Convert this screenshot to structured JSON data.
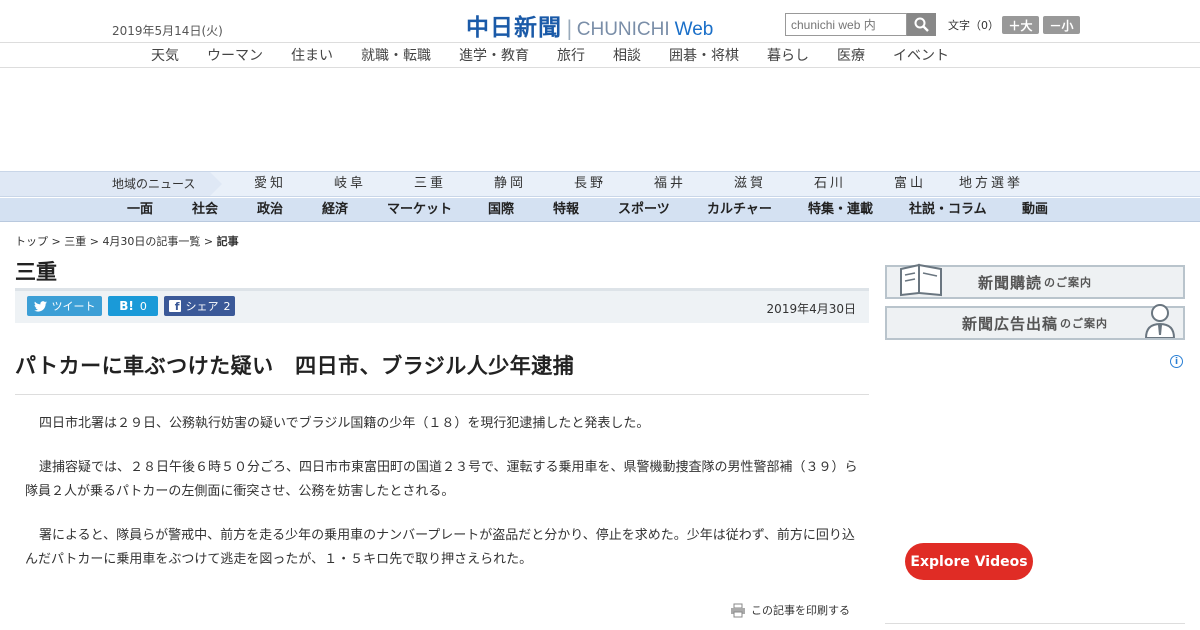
{
  "header": {
    "date": "2019年5月14日(火)",
    "logo_jp": "中日新聞",
    "logo_en": "CHUNICHI",
    "logo_web": "Web",
    "search_placeholder": "chunichi web 内",
    "text_size_label": "文字（0）",
    "enlarge_label": "＋大",
    "shrink_label": "－小"
  },
  "subnav": [
    "天気",
    "ウーマン",
    "住まい",
    "就職・転職",
    "進学・教育",
    "旅行",
    "相談",
    "囲碁・将棋",
    "暮らし",
    "医療",
    "イベント"
  ],
  "regional": {
    "label": "地域のニュース",
    "items": [
      "愛知",
      "岐阜",
      "三重",
      "静岡",
      "長野",
      "福井",
      "滋賀",
      "石川",
      "富山",
      "地方選挙"
    ]
  },
  "sections": [
    "一面",
    "社会",
    "政治",
    "経済",
    "マーケット",
    "国際",
    "特報",
    "スポーツ",
    "カルチャー",
    "特集・連載",
    "社説・コラム",
    "動画"
  ],
  "breadcrumb": {
    "top": "トップ",
    "sep": " > ",
    "region": "三重",
    "list": "4月30日の記事一覧",
    "current": "記事"
  },
  "category_title": "三重",
  "share": {
    "tweet": "ツイート",
    "hatena": "0",
    "facebook": "シェア",
    "facebook_count": "2"
  },
  "article": {
    "date": "2019年4月30日",
    "headline": "パトカーに車ぶつけた疑い　四日市、ブラジル人少年逮捕",
    "paragraphs": [
      "四日市北署は２９日、公務執行妨害の疑いでブラジル国籍の少年（１８）を現行犯逮捕したと発表した。",
      "逮捕容疑では、２８日午後６時５０分ごろ、四日市市東富田町の国道２３号で、運転する乗用車を、県警機動捜査隊の男性警部補（３９）ら隊員２人が乗るパトカーの左側面に衝突させ、公務を妨害したとされる。",
      "署によると、隊員らが警戒中、前方を走る少年の乗用車のナンバープレートが盗品だと分かり、停止を求めた。少年は従わず、前方に回り込んだパトカーに乗用車をぶつけて逃走を図ったが、１・５キロ先で取り押さえられた。"
    ],
    "print_label": "この記事を印刷する"
  },
  "sidebar": {
    "subscribe_main": "新聞購読",
    "subscribe_sub": "のご案内",
    "ad_main": "新聞広告出稿",
    "ad_sub": "のご案内",
    "explore_videos": "Explore Videos"
  }
}
